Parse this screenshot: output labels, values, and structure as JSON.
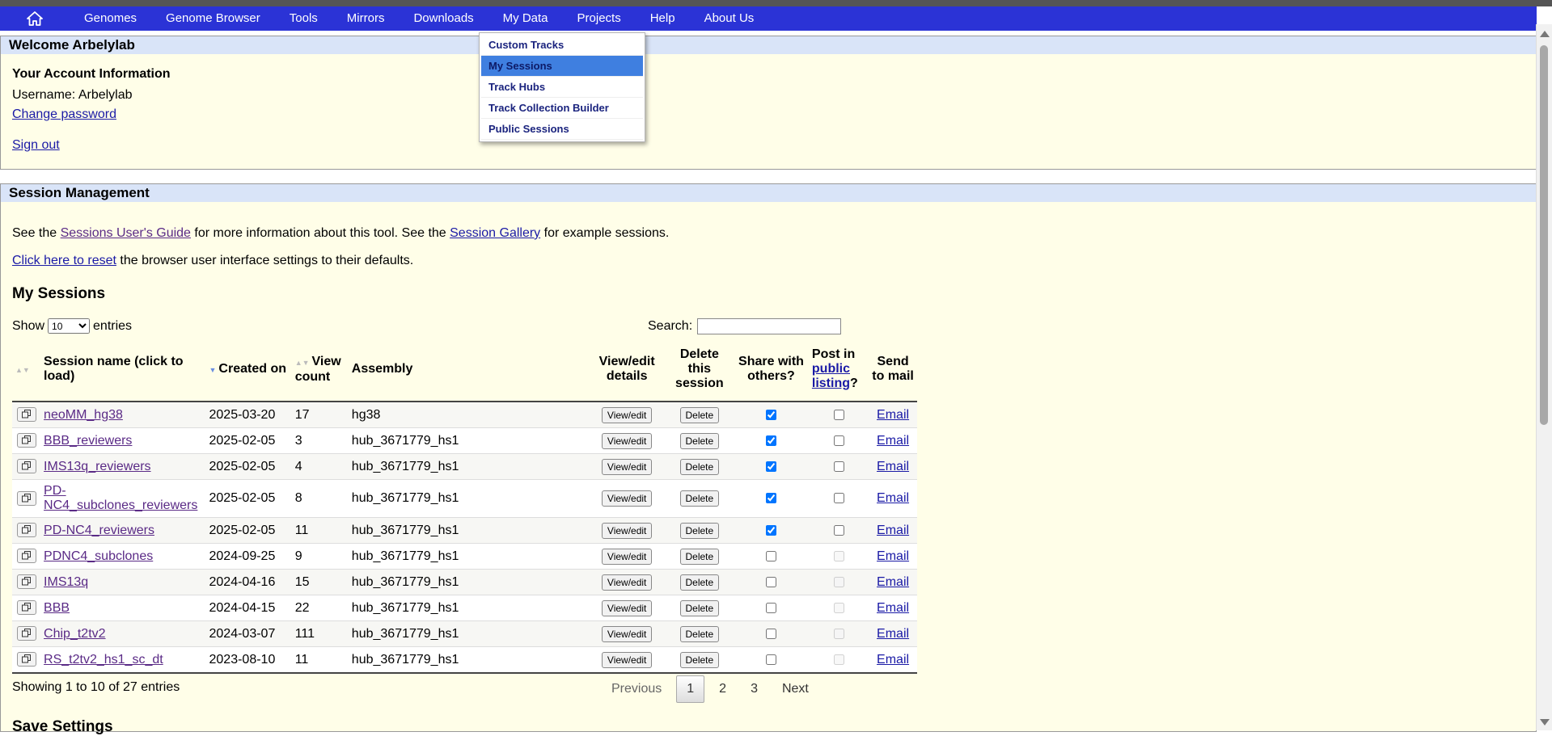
{
  "nav": {
    "items": [
      "Genomes",
      "Genome Browser",
      "Tools",
      "Mirrors",
      "Downloads",
      "My Data",
      "Projects",
      "Help",
      "About Us"
    ]
  },
  "dropdown": {
    "items": [
      "Custom Tracks",
      "My Sessions",
      "Track Hubs",
      "Track Collection Builder",
      "Public Sessions"
    ],
    "selected": "My Sessions"
  },
  "account": {
    "header": "Welcome Arbelylab",
    "title": "Your Account Information",
    "username_line": "Username: Arbelylab",
    "change_password": "Change password",
    "sign_out": "Sign out"
  },
  "sessions_panel": {
    "header": "Session Management",
    "line1_pre": "See the ",
    "line1_link1": "Sessions User's Guide",
    "line1_mid": " for more information about this tool. See the ",
    "line1_link2": "Session Gallery",
    "line1_post": " for example sessions.",
    "line2_link": "Click here to reset",
    "line2_post": " the browser user interface settings to their defaults.",
    "heading": "My Sessions",
    "show_label": "Show",
    "show_value": "10",
    "entries_label": "entries",
    "search_label": "Search:",
    "search_value": "",
    "columns": {
      "name": "Session name (click to load)",
      "created": "Created on",
      "views": "View count",
      "assembly": "Assembly",
      "view_edit": "View/edit details",
      "delete": "Delete this session",
      "share": "Share with others?",
      "post_pre": "Post in",
      "post_link": "public listing",
      "post_post": "?",
      "mail": "Send to mail"
    },
    "view_edit_label": "View/edit",
    "delete_label": "Delete",
    "email_label": "Email",
    "rows": [
      {
        "name": "neoMM_hg38",
        "created": "2025-03-20",
        "views": "17",
        "assembly": "hg38",
        "share": true,
        "post_enabled": true
      },
      {
        "name": "BBB_reviewers",
        "created": "2025-02-05",
        "views": "3",
        "assembly": "hub_3671779_hs1",
        "share": true,
        "post_enabled": true
      },
      {
        "name": "IMS13q_reviewers",
        "created": "2025-02-05",
        "views": "4",
        "assembly": "hub_3671779_hs1",
        "share": true,
        "post_enabled": true
      },
      {
        "name": "PD-NC4_subclones_reviewers",
        "created": "2025-02-05",
        "views": "8",
        "assembly": "hub_3671779_hs1",
        "share": true,
        "post_enabled": true
      },
      {
        "name": "PD-NC4_reviewers",
        "created": "2025-02-05",
        "views": "11",
        "assembly": "hub_3671779_hs1",
        "share": true,
        "post_enabled": true
      },
      {
        "name": "PDNC4_subclones",
        "created": "2024-09-25",
        "views": "9",
        "assembly": "hub_3671779_hs1",
        "share": false,
        "post_enabled": false
      },
      {
        "name": "IMS13q",
        "created": "2024-04-16",
        "views": "15",
        "assembly": "hub_3671779_hs1",
        "share": false,
        "post_enabled": false
      },
      {
        "name": "BBB",
        "created": "2024-04-15",
        "views": "22",
        "assembly": "hub_3671779_hs1",
        "share": false,
        "post_enabled": false
      },
      {
        "name": "Chip_t2tv2",
        "created": "2024-03-07",
        "views": "111",
        "assembly": "hub_3671779_hs1",
        "share": false,
        "post_enabled": false
      },
      {
        "name": "RS_t2tv2_hs1_sc_dt",
        "created": "2023-08-10",
        "views": "11",
        "assembly": "hub_3671779_hs1",
        "share": false,
        "post_enabled": false
      }
    ],
    "info": "Showing 1 to 10 of 27 entries",
    "pager": {
      "previous": "Previous",
      "pages": [
        "1",
        "2",
        "3"
      ],
      "current": "1",
      "next": "Next"
    },
    "save_settings": "Save Settings"
  }
}
